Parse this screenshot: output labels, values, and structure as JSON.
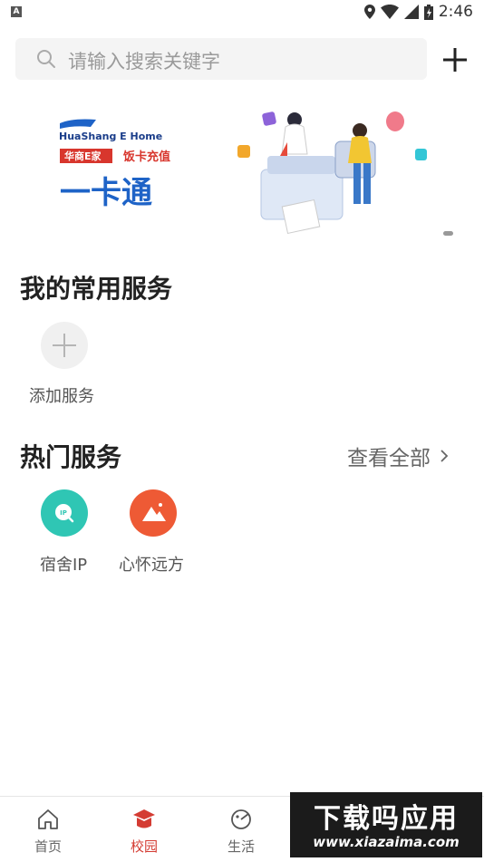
{
  "status_bar": {
    "time": "2:46",
    "notification_icon": "a-notification-icon"
  },
  "search": {
    "placeholder": "请输入搜索关键字"
  },
  "banner": {
    "brand": "HuaShang E Home",
    "tag1": "华商E家",
    "tag2": "饭卡充值",
    "headline": "一卡通"
  },
  "my_services": {
    "title": "我的常用服务",
    "add_label": "添加服务"
  },
  "hot_services": {
    "title": "热门服务",
    "view_all": "查看全部",
    "items": [
      {
        "label": "宿舍IP",
        "icon": "ip-icon",
        "color": "#2fc6b4"
      },
      {
        "label": "心怀远方",
        "icon": "mountain-icon",
        "color": "#ee5a35"
      }
    ]
  },
  "tabbar": {
    "items": [
      {
        "label": "首页",
        "icon": "home-icon"
      },
      {
        "label": "校园",
        "icon": "campus-icon",
        "active": true
      },
      {
        "label": "生活",
        "icon": "life-icon"
      }
    ]
  },
  "watermark": {
    "title": "下载吗应用",
    "url": "www.xiazaima.com"
  },
  "colors": {
    "accent": "#d43c33",
    "teal": "#2fc6b4",
    "orange": "#ee5a35"
  }
}
